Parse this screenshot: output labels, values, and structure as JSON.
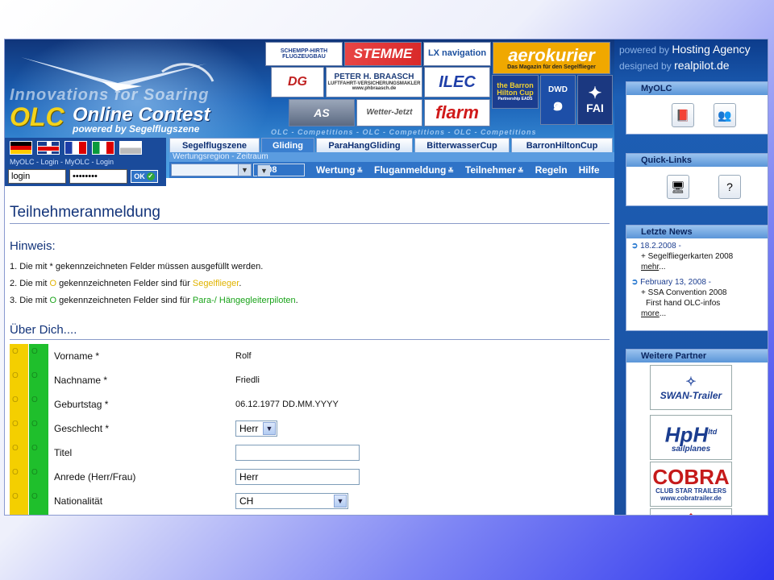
{
  "header": {
    "tagline": "Innovations for Soaring",
    "logo_olc": "OLC",
    "logo_online_contest": "Online Contest",
    "logo_powered": "powered by Segelflugszene",
    "olc_strip": "OLC - Competitions - OLC - Competitions - OLC - Competitions",
    "sponsors": {
      "schempp": "SCHEMPP-HIRTH FLUGZEUGBAU",
      "stemme": "STEMME",
      "lx": "LX navigation",
      "aerokurier": "aerokurier",
      "aerokurier_sub": "Das Magazin für den Segelflieger",
      "dg": "DG",
      "braasch": "PETER H. BRAASCH",
      "braasch_sub": "LUFTFAHRT-VERSICHERUNGSMAKLER",
      "braasch_url": "www.phbraasch.de",
      "ilec": "ILEC",
      "barron": "the Barron Hilton Cup",
      "barron_sub": "Partnership EADS",
      "dwd": "DWD",
      "fai": "FAI",
      "as": "AS",
      "wetter": "Wetter-Jetzt",
      "flarm": "flarm"
    }
  },
  "login": {
    "bar_text": "MyOLC - Login - MyOLC - Login",
    "username_value": "login",
    "password_value": "••••••••",
    "ok_label": "OK"
  },
  "tabs": [
    "Segelflugszene",
    "Gliding",
    "ParaHangGliding",
    "BitterwasserCup",
    "BarronHiltonCup"
  ],
  "active_tab": "Gliding",
  "region_label": "Wertungsregion - Zeitraum",
  "year_value": "2008",
  "nav": {
    "wertung": "Wertung",
    "fluganmeldung": "Fluganmeldung",
    "teilnehmer": "Teilnehmer",
    "regeln": "Regeln",
    "hilfe": "Hilfe"
  },
  "content": {
    "page_title": "Teilnehmeranmeldung",
    "hinweis_title": "Hinweis:",
    "note1": "1. Die mit  * gekennzeichneten Felder müssen ausgefüllt werden.",
    "note2_pre": "2. Die mit ",
    "note2_marker": "O",
    "note2_mid": " gekennzeichneten Felder sind für ",
    "note2_target": "Segelflieger",
    "note2_end": ".",
    "note3_pre": "3. Die mit ",
    "note3_marker": "O",
    "note3_mid": " gekennzeichneten Felder sind für ",
    "note3_target": "Para-/ Hängegleiterpiloten",
    "note3_end": ".",
    "section_title": "Über Dich....",
    "marker": "O",
    "fields": {
      "vorname": {
        "label": "Vorname *",
        "value": "Rolf"
      },
      "nachname": {
        "label": "Nachname *",
        "value": "Friedli"
      },
      "geburtstag": {
        "label": "Geburtstag *",
        "value": "06.12.1977  DD.MM.YYYY"
      },
      "geschlecht": {
        "label": "Geschlecht *",
        "value": "Herr"
      },
      "titel": {
        "label": "Titel",
        "value": ""
      },
      "anrede": {
        "label": "Anrede (Herr/Frau)",
        "value": "Herr"
      },
      "nationalitaet": {
        "label": "Nationalität",
        "value": "CH"
      }
    }
  },
  "sidebar": {
    "powered_pre": "powered by",
    "powered_name": "Hosting Agency",
    "designed_pre": "designed by",
    "designed_name": "realpilot",
    "designed_tld": ".de",
    "myolc_title": "MyOLC",
    "quicklinks_title": "Quick-Links",
    "news_title": "Letzte News",
    "news": [
      {
        "date": "18.2.2008 -",
        "line1": "+ Segelfliegerkarten 2008",
        "link": "mehr",
        "tail": "..."
      },
      {
        "date": "February 13, 2008 -",
        "line1": "+ SSA Convention 2008",
        "line2": "First hand OLC-infos",
        "link": "more",
        "tail": "..."
      }
    ],
    "partners_title": "Weitere Partner",
    "partners": {
      "swan": "SWAN-Trailer",
      "hph": "HpH",
      "hph_ltd": "ltd",
      "hph_sub": "sailplanes",
      "cobra": "COBRA",
      "cobra_sub": "CLUB STAR TRAILERS",
      "cobra_url": "www.cobratrailer.de"
    }
  }
}
